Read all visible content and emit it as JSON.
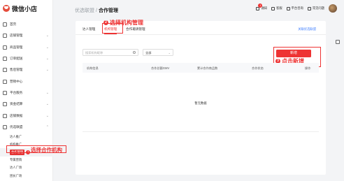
{
  "app": {
    "name": "微信小店"
  },
  "sidebar": {
    "items": [
      {
        "label": "首页",
        "icon": "home-icon"
      },
      {
        "label": "店铺管理",
        "icon": "shop-icon"
      },
      {
        "label": "商品管理",
        "icon": "goods-icon"
      },
      {
        "label": "订单配送",
        "icon": "order-icon"
      },
      {
        "label": "售后管理",
        "icon": "aftersale-icon"
      },
      {
        "label": "营销中心",
        "icon": "marketing-icon"
      },
      {
        "label": "平台服务",
        "icon": "service-icon"
      },
      {
        "label": "资金结算",
        "icon": "finance-icon"
      },
      {
        "label": "店铺数据",
        "icon": "data-icon"
      },
      {
        "label": "优选联盟",
        "icon": "alliance-icon"
      }
    ],
    "subitems": [
      {
        "label": "达人推广"
      },
      {
        "label": "机构推广"
      },
      {
        "label": "合作管理",
        "active": true,
        "step": "1"
      },
      {
        "label": "专属营销"
      },
      {
        "label": "达人广场"
      },
      {
        "label": "团长广场"
      }
    ],
    "annotation": "选择合作机构"
  },
  "header": {
    "breadcrumb_parent": "优选联盟",
    "breadcrumb_sep": "/",
    "breadcrumb_current": "合作管理",
    "tools": [
      {
        "label": "通知",
        "icon": "bell-icon",
        "badge": "1"
      },
      {
        "label": "客服",
        "icon": "service-chat-icon"
      },
      {
        "label": "平台咨询",
        "icon": "consult-icon"
      },
      {
        "label": "常见问题",
        "icon": "faq-icon"
      }
    ]
  },
  "tabs": {
    "items": [
      "达人管理",
      "机构管理",
      "合作邀请管理"
    ],
    "active_index": 1,
    "link": "关联优选联盟",
    "annotation_step": "2",
    "annotation": "选择机构管理"
  },
  "filters": {
    "search_placeholder": "搜索机构昵称",
    "select_value": "全部"
  },
  "actions": {
    "add_label": "新增",
    "annotation_step": "3",
    "annotation": "点击新增"
  },
  "table": {
    "columns": [
      "机构信息",
      "合作总额GMV",
      "累计合作商品数",
      "合作状态",
      "操作"
    ],
    "empty_text": "暂无数据"
  }
}
